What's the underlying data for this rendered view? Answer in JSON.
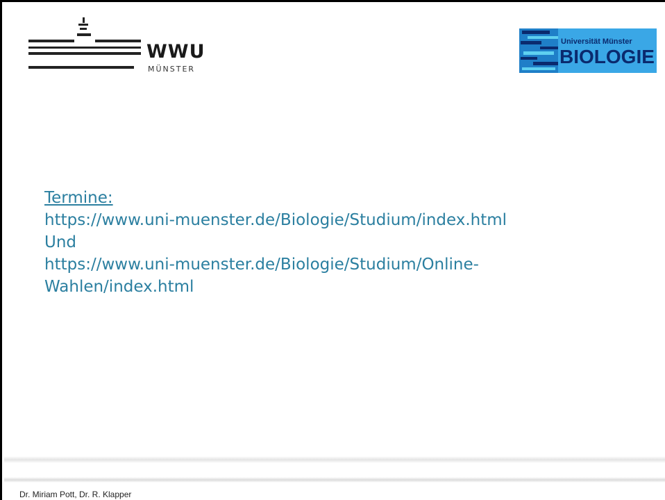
{
  "header": {
    "wwu_logo": {
      "name": "WWU",
      "subname": "MÜNSTER"
    },
    "biologie_logo": {
      "university": "Universität Münster",
      "title": "BIOLOGIE"
    }
  },
  "content": {
    "heading": "Termine:",
    "lines": [
      "https://www.uni-muenster.de/Biologie/Studium/index.html",
      "Und",
      "https://www.uni-muenster.de/Biologie/Studium/Online-",
      "Wahlen/index.html"
    ]
  },
  "footer": {
    "authors": "Dr. Miriam Pott, Dr. R. Klapper"
  },
  "colors": {
    "text_accent": "#2b7fa0",
    "bio_blue": "#1f7fc8",
    "bio_dark": "#0a2a6e"
  }
}
